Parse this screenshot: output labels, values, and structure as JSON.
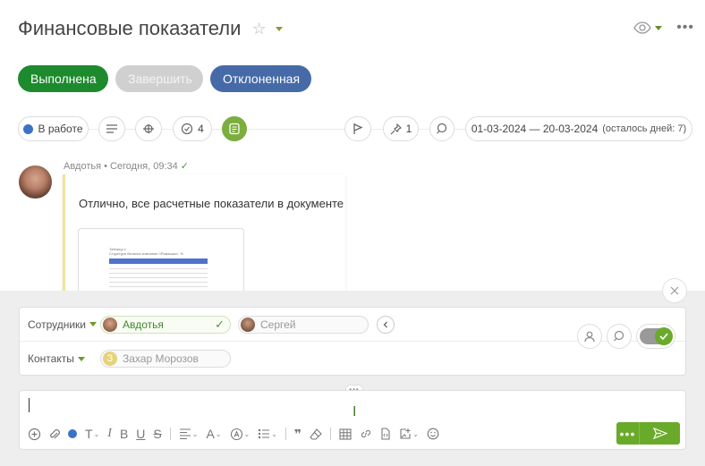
{
  "header": {
    "title": "Финансовые показатели"
  },
  "status_buttons": {
    "done": "Выполнена",
    "finish": "Завершить",
    "rejected": "Отклоненная"
  },
  "toolbar": {
    "state_label": "В работе",
    "checklist_count": "4",
    "pin_count": "1",
    "date_range": "01-03-2024 — 20-03-2024",
    "days_left": "(осталось дней: 7)"
  },
  "comment": {
    "author": "Авдотья",
    "time": "Сегодня, 09:34",
    "text": "Отлично, все расчетные показатели в документе",
    "doc_caption_1": "Таблица 1",
    "doc_caption_2": "Структура баланса компании «Ромашка», %"
  },
  "assignees": {
    "employees_label": "Сотрудники",
    "employees": [
      "Авдотья",
      "Сергей"
    ],
    "contacts_label": "Контакты",
    "contact_initial": "З",
    "contact_name": "Захар Морозов"
  },
  "editor": {
    "more_label": "•••"
  },
  "colors": {
    "accent_green": "#6aaa2a",
    "status_done": "#1d8a2e",
    "status_rejected": "#466aa8",
    "state_dot": "#3b73c4"
  }
}
